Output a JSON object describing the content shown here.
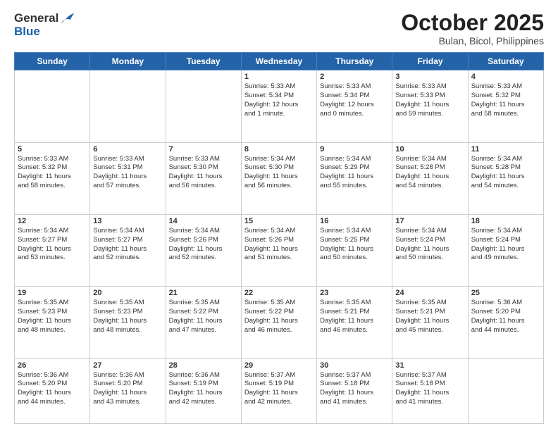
{
  "logo": {
    "line1": "General",
    "line2": "Blue"
  },
  "title": "October 2025",
  "subtitle": "Bulan, Bicol, Philippines",
  "days_of_week": [
    "Sunday",
    "Monday",
    "Tuesday",
    "Wednesday",
    "Thursday",
    "Friday",
    "Saturday"
  ],
  "weeks": [
    [
      {
        "day": "",
        "content": ""
      },
      {
        "day": "",
        "content": ""
      },
      {
        "day": "",
        "content": ""
      },
      {
        "day": "1",
        "content": "Sunrise: 5:33 AM\nSunset: 5:34 PM\nDaylight: 12 hours\nand 1 minute."
      },
      {
        "day": "2",
        "content": "Sunrise: 5:33 AM\nSunset: 5:34 PM\nDaylight: 12 hours\nand 0 minutes."
      },
      {
        "day": "3",
        "content": "Sunrise: 5:33 AM\nSunset: 5:33 PM\nDaylight: 11 hours\nand 59 minutes."
      },
      {
        "day": "4",
        "content": "Sunrise: 5:33 AM\nSunset: 5:32 PM\nDaylight: 11 hours\nand 58 minutes."
      }
    ],
    [
      {
        "day": "5",
        "content": "Sunrise: 5:33 AM\nSunset: 5:32 PM\nDaylight: 11 hours\nand 58 minutes."
      },
      {
        "day": "6",
        "content": "Sunrise: 5:33 AM\nSunset: 5:31 PM\nDaylight: 11 hours\nand 57 minutes."
      },
      {
        "day": "7",
        "content": "Sunrise: 5:33 AM\nSunset: 5:30 PM\nDaylight: 11 hours\nand 56 minutes."
      },
      {
        "day": "8",
        "content": "Sunrise: 5:34 AM\nSunset: 5:30 PM\nDaylight: 11 hours\nand 56 minutes."
      },
      {
        "day": "9",
        "content": "Sunrise: 5:34 AM\nSunset: 5:29 PM\nDaylight: 11 hours\nand 55 minutes."
      },
      {
        "day": "10",
        "content": "Sunrise: 5:34 AM\nSunset: 5:28 PM\nDaylight: 11 hours\nand 54 minutes."
      },
      {
        "day": "11",
        "content": "Sunrise: 5:34 AM\nSunset: 5:28 PM\nDaylight: 11 hours\nand 54 minutes."
      }
    ],
    [
      {
        "day": "12",
        "content": "Sunrise: 5:34 AM\nSunset: 5:27 PM\nDaylight: 11 hours\nand 53 minutes."
      },
      {
        "day": "13",
        "content": "Sunrise: 5:34 AM\nSunset: 5:27 PM\nDaylight: 11 hours\nand 52 minutes."
      },
      {
        "day": "14",
        "content": "Sunrise: 5:34 AM\nSunset: 5:26 PM\nDaylight: 11 hours\nand 52 minutes."
      },
      {
        "day": "15",
        "content": "Sunrise: 5:34 AM\nSunset: 5:26 PM\nDaylight: 11 hours\nand 51 minutes."
      },
      {
        "day": "16",
        "content": "Sunrise: 5:34 AM\nSunset: 5:25 PM\nDaylight: 11 hours\nand 50 minutes."
      },
      {
        "day": "17",
        "content": "Sunrise: 5:34 AM\nSunset: 5:24 PM\nDaylight: 11 hours\nand 50 minutes."
      },
      {
        "day": "18",
        "content": "Sunrise: 5:34 AM\nSunset: 5:24 PM\nDaylight: 11 hours\nand 49 minutes."
      }
    ],
    [
      {
        "day": "19",
        "content": "Sunrise: 5:35 AM\nSunset: 5:23 PM\nDaylight: 11 hours\nand 48 minutes."
      },
      {
        "day": "20",
        "content": "Sunrise: 5:35 AM\nSunset: 5:23 PM\nDaylight: 11 hours\nand 48 minutes."
      },
      {
        "day": "21",
        "content": "Sunrise: 5:35 AM\nSunset: 5:22 PM\nDaylight: 11 hours\nand 47 minutes."
      },
      {
        "day": "22",
        "content": "Sunrise: 5:35 AM\nSunset: 5:22 PM\nDaylight: 11 hours\nand 46 minutes."
      },
      {
        "day": "23",
        "content": "Sunrise: 5:35 AM\nSunset: 5:21 PM\nDaylight: 11 hours\nand 46 minutes."
      },
      {
        "day": "24",
        "content": "Sunrise: 5:35 AM\nSunset: 5:21 PM\nDaylight: 11 hours\nand 45 minutes."
      },
      {
        "day": "25",
        "content": "Sunrise: 5:36 AM\nSunset: 5:20 PM\nDaylight: 11 hours\nand 44 minutes."
      }
    ],
    [
      {
        "day": "26",
        "content": "Sunrise: 5:36 AM\nSunset: 5:20 PM\nDaylight: 11 hours\nand 44 minutes."
      },
      {
        "day": "27",
        "content": "Sunrise: 5:36 AM\nSunset: 5:20 PM\nDaylight: 11 hours\nand 43 minutes."
      },
      {
        "day": "28",
        "content": "Sunrise: 5:36 AM\nSunset: 5:19 PM\nDaylight: 11 hours\nand 42 minutes."
      },
      {
        "day": "29",
        "content": "Sunrise: 5:37 AM\nSunset: 5:19 PM\nDaylight: 11 hours\nand 42 minutes."
      },
      {
        "day": "30",
        "content": "Sunrise: 5:37 AM\nSunset: 5:18 PM\nDaylight: 11 hours\nand 41 minutes."
      },
      {
        "day": "31",
        "content": "Sunrise: 5:37 AM\nSunset: 5:18 PM\nDaylight: 11 hours\nand 41 minutes."
      },
      {
        "day": "",
        "content": ""
      }
    ]
  ]
}
